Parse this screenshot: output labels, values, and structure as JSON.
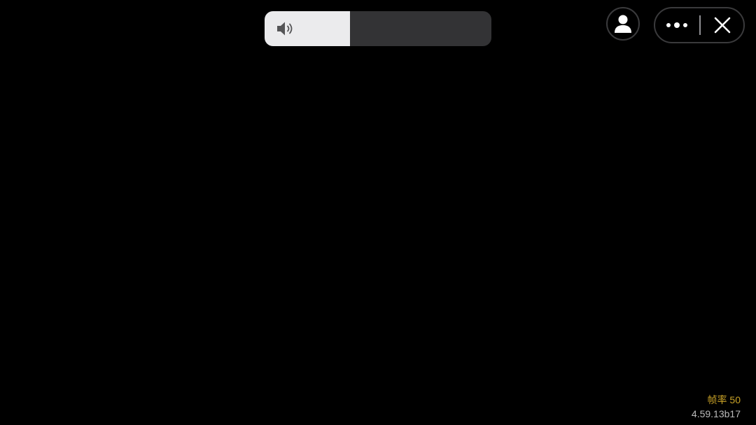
{
  "volume": {
    "level": 0.375,
    "icon": "speaker-icon"
  },
  "toolbar": {
    "profile_icon": "person-icon",
    "more_icon": "more-dots-icon",
    "close_icon": "close-icon"
  },
  "debug": {
    "fps_label": "帧率",
    "fps_value": "50",
    "version": "4.59.13b17"
  },
  "colors": {
    "background": "#000000",
    "hud_fill": "#ebebed",
    "hud_track": "#333335",
    "fps_text": "#c9a227",
    "version_text": "#bcbcbc"
  }
}
